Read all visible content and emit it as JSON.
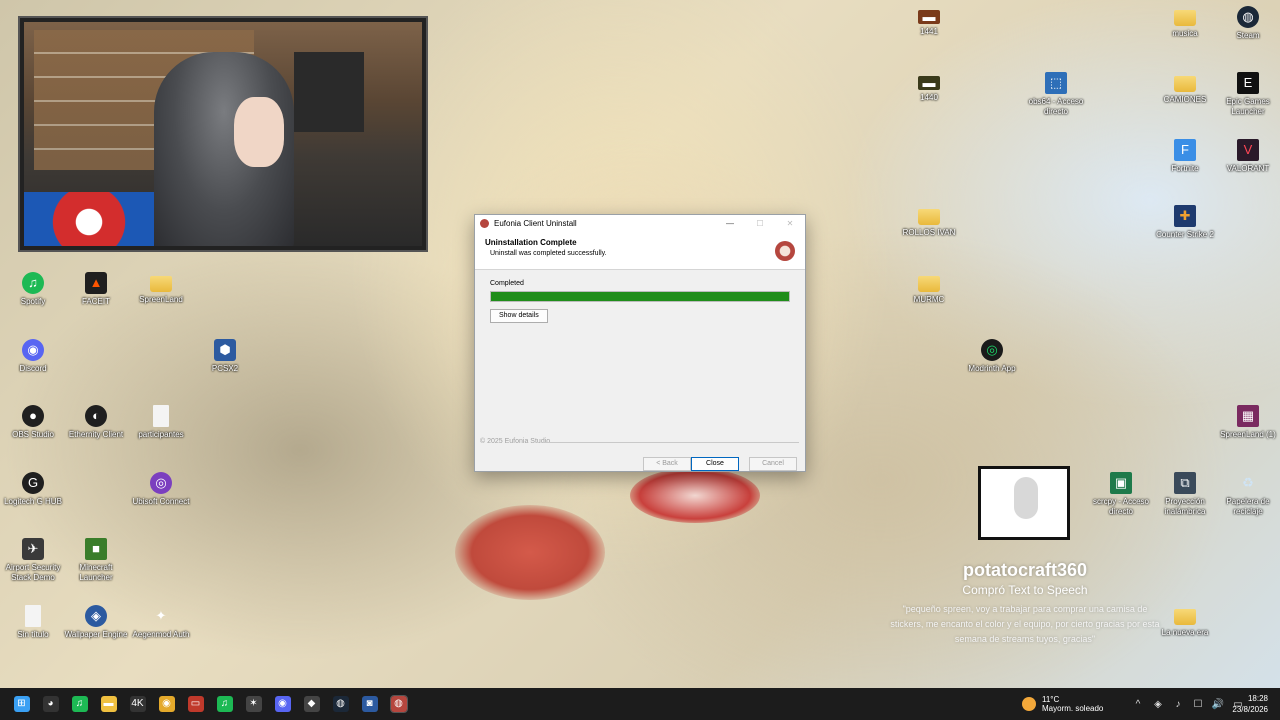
{
  "window": {
    "title": "Eufonia Client Uninstall",
    "header_title": "Uninstallation Complete",
    "header_subtitle": "Uninstall was completed successfully.",
    "status": "Completed",
    "progress": 1.0,
    "show_details": "Show details",
    "brand": "© 2025 Eufonia Studio",
    "back": "< Back",
    "close": "Close",
    "cancel": "Cancel",
    "progress_color": "#1f8d1a"
  },
  "desktop_icons_left": [
    {
      "label": "Spotify",
      "glyph": "♫"
    },
    {
      "label": "FACEIT",
      "glyph": "▲"
    },
    {
      "label": "SpreenLand",
      "glyph": ""
    },
    {
      "label": "Discord",
      "glyph": "◉"
    },
    {
      "label": "PCSX2",
      "glyph": "⬢"
    },
    {
      "label": "OBS Studio",
      "glyph": "●"
    },
    {
      "label": "Ethernity Client",
      "glyph": "◐"
    },
    {
      "label": "participantes",
      "glyph": ""
    },
    {
      "label": "Logitech G HUB",
      "glyph": "G"
    },
    {
      "label": "Ubisoft Connect",
      "glyph": "◎"
    },
    {
      "label": "Airport Security Stack Demo",
      "glyph": "✈"
    },
    {
      "label": "Minecraft Launcher",
      "glyph": "■"
    },
    {
      "label": "Sin título",
      "glyph": ""
    },
    {
      "label": "Wallpaper Engine",
      "glyph": "◈"
    },
    {
      "label": "Aegenmod Auth",
      "glyph": "✦"
    }
  ],
  "desktop_icons_right": [
    {
      "label": "1441",
      "glyph": "▬"
    },
    {
      "label": "1440",
      "glyph": "▬"
    },
    {
      "label": "obs64 - Acceso directo",
      "glyph": "⬚"
    },
    {
      "label": "CAMIONES",
      "glyph": ""
    },
    {
      "label": "ROLLOS IVAN",
      "glyph": ""
    },
    {
      "label": "MURMC",
      "glyph": ""
    },
    {
      "label": "Modrinth App",
      "glyph": "◎"
    },
    {
      "label": "musica",
      "glyph": ""
    },
    {
      "label": "Steam",
      "glyph": "◍"
    },
    {
      "label": "Epic Games Launcher",
      "glyph": "E"
    },
    {
      "label": "Fortnite",
      "glyph": "F"
    },
    {
      "label": "VALORANT",
      "glyph": "V"
    },
    {
      "label": "Counter Strike 2",
      "glyph": "✚"
    },
    {
      "label": "SpreenLand (1)",
      "glyph": "▦"
    },
    {
      "label": "scrcpy - Acceso directo",
      "glyph": "▣"
    },
    {
      "label": "Proyección inalámbrica",
      "glyph": "⧉"
    },
    {
      "label": "Papelera de reciclaje",
      "glyph": "♻"
    },
    {
      "label": "La nueva era",
      "glyph": ""
    }
  ],
  "tts": {
    "user": "potatocraft360",
    "action": "Compró Text to Speech",
    "message": "\"pequeño spreen, voy a trabajar para comprar una camisa de stickers, me encanto el color y el equipo, por cierto gracias por esta semana de streams tuyos, gracias\""
  },
  "taskbar": {
    "weather_temp": "11°C",
    "weather_desc": "Mayorm. soleado",
    "time": "18:28",
    "date": "23/8/2026",
    "icons": [
      {
        "name": "start",
        "glyph": "⊞",
        "color": "#3aa0f3"
      },
      {
        "name": "app1",
        "glyph": "◕",
        "color": "#333333"
      },
      {
        "name": "spotify",
        "glyph": "♫",
        "color": "#1db954"
      },
      {
        "name": "explorer",
        "glyph": "▬",
        "color": "#f0c040"
      },
      {
        "name": "4k",
        "glyph": "4K",
        "color": "#333333"
      },
      {
        "name": "chrome",
        "glyph": "◉",
        "color": "#e4a92b"
      },
      {
        "name": "mixer",
        "glyph": "▭",
        "color": "#c0392b"
      },
      {
        "name": "spotify2",
        "glyph": "♫",
        "color": "#1db954"
      },
      {
        "name": "app2",
        "glyph": "✶",
        "color": "#444444"
      },
      {
        "name": "discord",
        "glyph": "◉",
        "color": "#5865f2"
      },
      {
        "name": "app3",
        "glyph": "◆",
        "color": "#444444"
      },
      {
        "name": "steam",
        "glyph": "◍",
        "color": "#1b2838"
      },
      {
        "name": "app4",
        "glyph": "◙",
        "color": "#2c5aa0"
      },
      {
        "name": "eufonia",
        "glyph": "◍",
        "color": "#b5463e"
      }
    ],
    "tray": [
      "^",
      "◈",
      "♪",
      "☐",
      "🔊",
      "▭"
    ]
  }
}
